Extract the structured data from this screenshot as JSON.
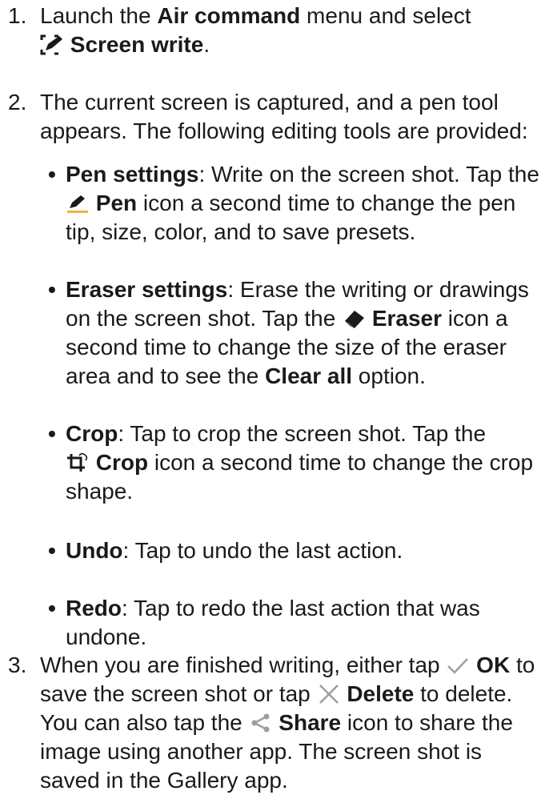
{
  "steps": [
    {
      "num": "1.",
      "t1": "Launch the ",
      "b1": "Air command",
      "t2": " menu and select",
      "b2": "Screen write",
      "t3": "."
    },
    {
      "num": "2.",
      "text": "The current screen is captured, and a pen tool appears. The following editing tools are provided:"
    },
    {
      "num": "3.",
      "t1": "When you are finished writing, either tap ",
      "b_ok": "OK",
      "t2": " to save the screen shot or tap ",
      "b_delete": "Delete",
      "t3": " to delete. You can also tap the ",
      "b_share": "Share",
      "t4": " icon to share the image using another app. The screen shot is saved in the Gallery app."
    }
  ],
  "tools": [
    {
      "name": "Pen settings",
      "t1": ": Write on the screen shot. Tap the ",
      "icon_label": "Pen",
      "t2": " icon a second time to change the pen tip, size, color, and to save presets."
    },
    {
      "name": "Eraser settings",
      "t1": ": Erase the writing or drawings on the screen shot. Tap the ",
      "icon_label": "Eraser",
      "t2": " icon a second time to change the size of the eraser area and to see the ",
      "b_extra": "Clear all",
      "t3": " option."
    },
    {
      "name": "Crop",
      "t1": ": Tap to crop the screen shot. Tap the ",
      "icon_label": "Crop",
      "t2": " icon a second time to change the crop shape."
    },
    {
      "name": "Undo",
      "t1": ": Tap to undo the last action."
    },
    {
      "name": "Redo",
      "t1": ": Tap to redo the last action that was undone."
    }
  ],
  "bullet_char": "•",
  "icons": [
    "screen-write-icon",
    "pen-icon",
    "eraser-icon",
    "crop-icon",
    "check-icon",
    "delete-icon",
    "share-icon"
  ],
  "colors": {
    "text": "#1a1a1a",
    "icon_gray": "#9e9e9e",
    "accent": "#f2b33d"
  }
}
